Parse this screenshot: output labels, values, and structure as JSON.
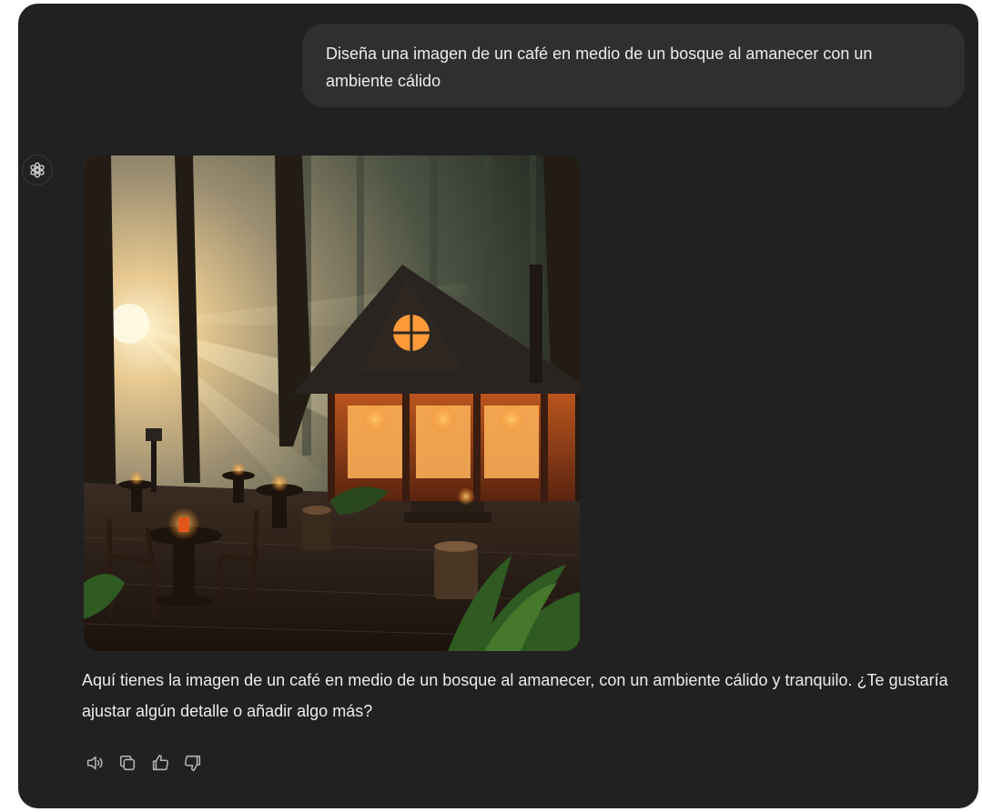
{
  "conversation": {
    "user_message": "Diseña una imagen de un café en medio de un bosque al amanecer con un ambiente cálido",
    "assistant_message": "Aquí tienes la imagen de un café en medio de un bosque al amanecer, con un ambiente cálido y tranquilo. ¿Te gustaría ajustar algún detalle o añadir algo más?",
    "assistant_avatar_icon": "openai-logo-icon",
    "image_subject": "forest café at dawn"
  },
  "actions": [
    {
      "icon": "speaker-icon"
    },
    {
      "icon": "copy-icon"
    },
    {
      "icon": "thumbs-up-icon"
    },
    {
      "icon": "thumbs-down-icon"
    }
  ],
  "colors": {
    "background": "#212121",
    "user_bubble": "#2f2f2f",
    "text": "#ececec",
    "icon": "#b4b4b4"
  }
}
